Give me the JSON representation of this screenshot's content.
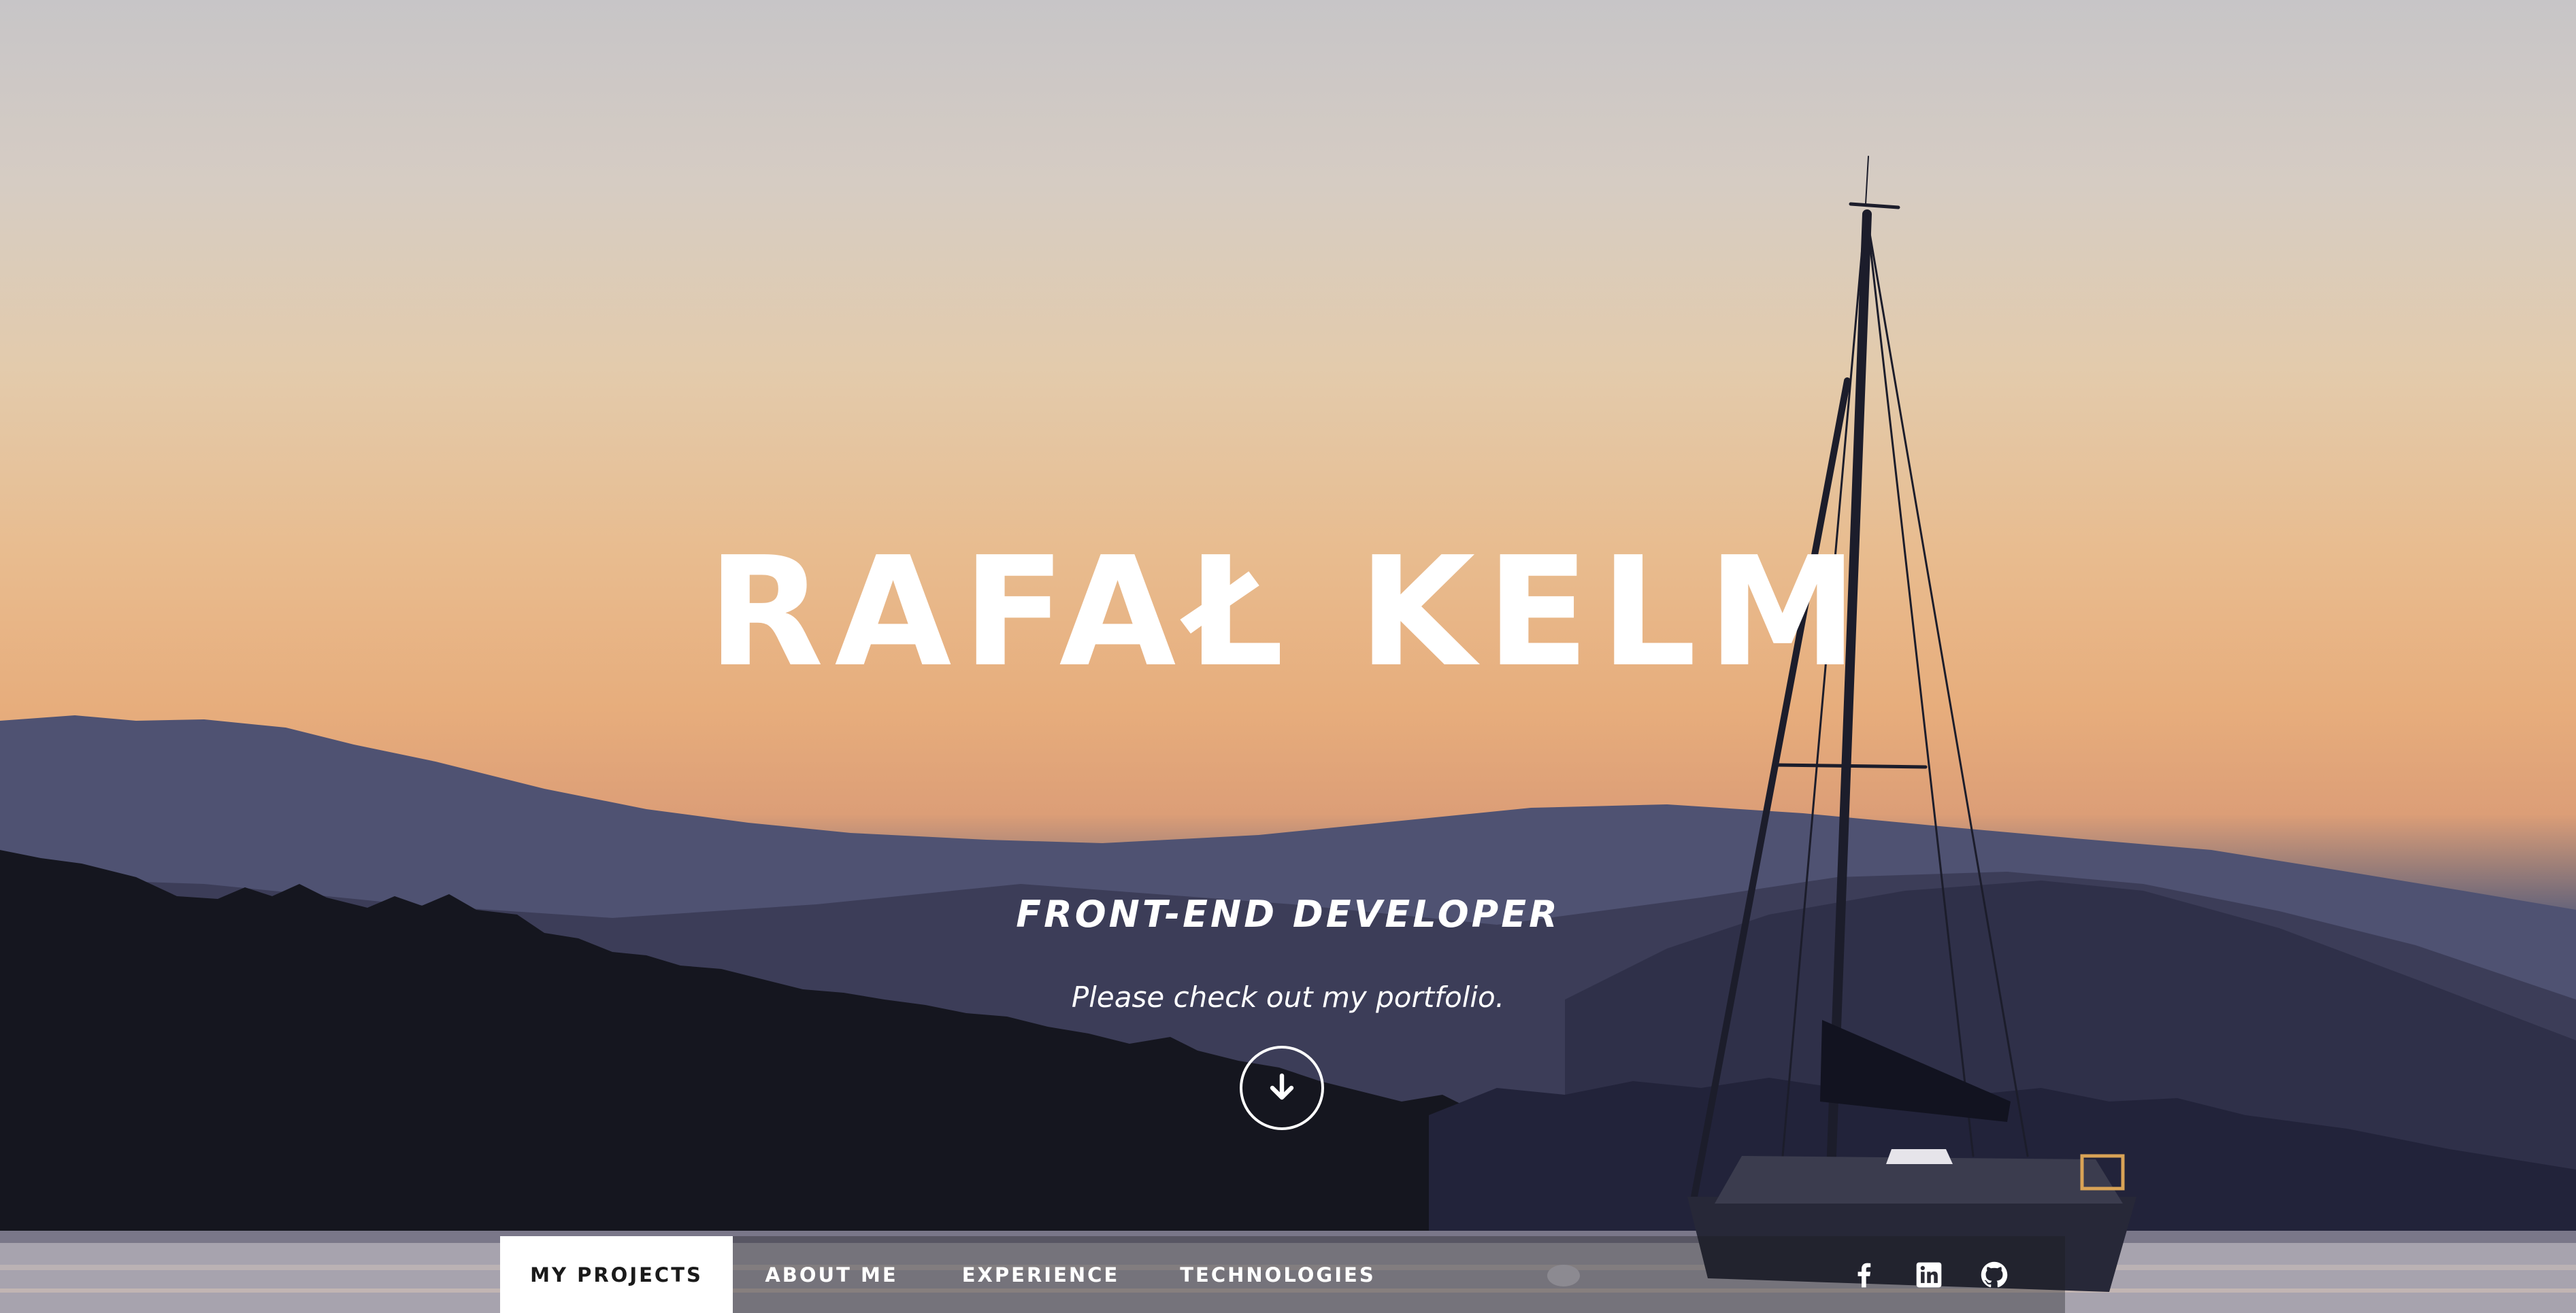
{
  "hero": {
    "name": "RAFAŁ KELM",
    "role": "FRONT-END DEVELOPER",
    "tagline": "Please check out my portfolio.",
    "scroll_icon": "arrow-down-icon"
  },
  "nav": {
    "items": [
      {
        "label": "MY PROJECTS",
        "active": true
      },
      {
        "label": "ABOUT ME",
        "active": false
      },
      {
        "label": "EXPERIENCE",
        "active": false
      },
      {
        "label": "TECHNOLOGIES",
        "active": false
      }
    ],
    "socials": [
      {
        "icon": "facebook-icon"
      },
      {
        "icon": "linkedin-icon"
      },
      {
        "icon": "github-icon"
      }
    ]
  },
  "colors": {
    "text": "#ffffff",
    "nav_active_bg": "#ffffff",
    "nav_active_text": "#1a1a1a",
    "sky_top": "#c7c5c7",
    "sky_horizon": "#e7ad7c"
  }
}
